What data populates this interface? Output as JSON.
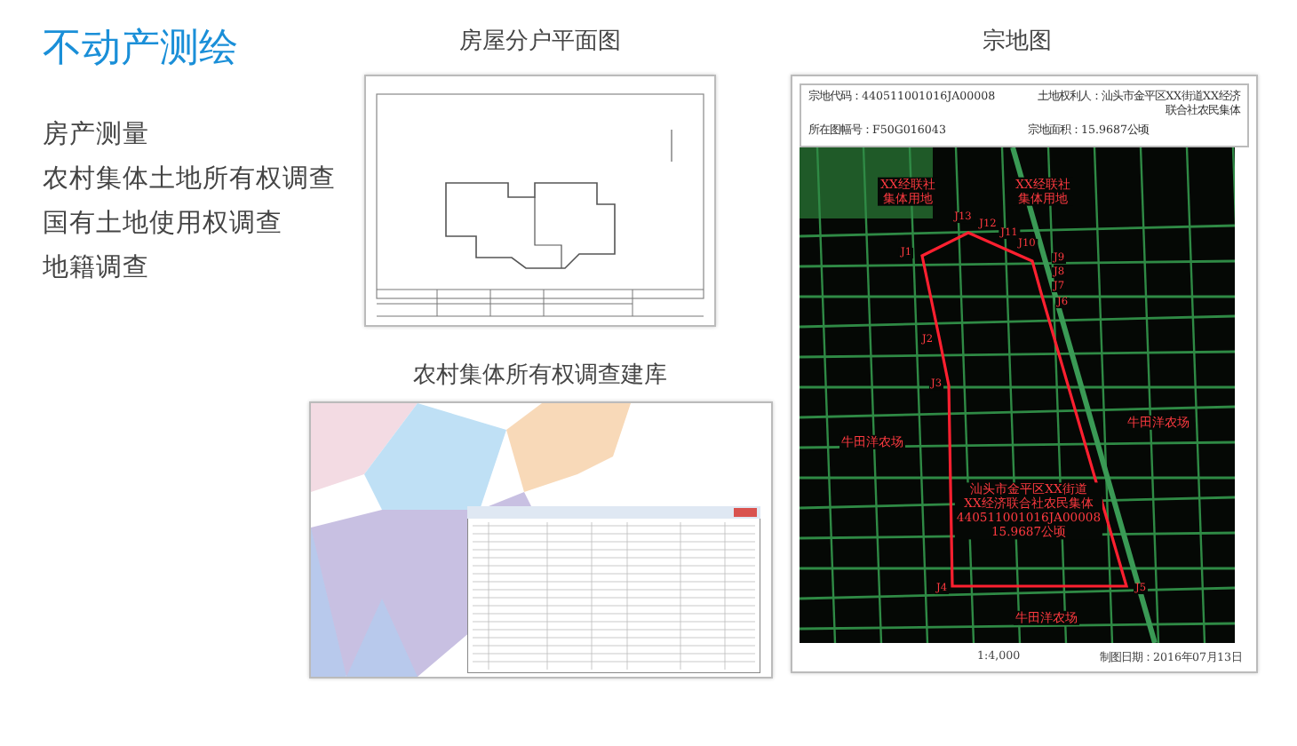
{
  "slide": {
    "title": "不动产测绘"
  },
  "bullets": [
    "房产测量",
    "农村集体土地所有权调查",
    "国有土地使用权调查",
    "地籍调查"
  ],
  "panels": [
    {
      "kind": "floor_plan",
      "title": "房屋分户平面图"
    },
    {
      "kind": "database",
      "title": "农村集体所有权调查建库"
    },
    {
      "kind": "parcel_map",
      "title": "宗地图",
      "header": [
        {
          "label": "宗地代码：440511001016JA00008",
          "value": "土地权利人：汕头市金平区XX街道XX经济联合社农民集体"
        },
        {
          "label": "所在图幅号：F50G016043",
          "value": "宗地面积：15.9687公顷"
        }
      ],
      "area_labels": [
        "XX经联社集体用地",
        "XX经联社集体用地",
        "牛田洋农场",
        "牛田洋农场",
        "牛田洋农场"
      ],
      "parcel_label": [
        "汕头市金平区XX街道",
        "XX经济联合社农民集体",
        "440511001016JA00008",
        "15.9687公顷"
      ],
      "points": [
        "J13",
        "J12",
        "J11",
        "J1",
        "J10",
        "J9",
        "J8",
        "J7",
        "J6",
        "J2",
        "J3",
        "J4",
        "J5"
      ],
      "scale": "1:4,000",
      "date": "制图日期：2016年07月13日"
    }
  ]
}
